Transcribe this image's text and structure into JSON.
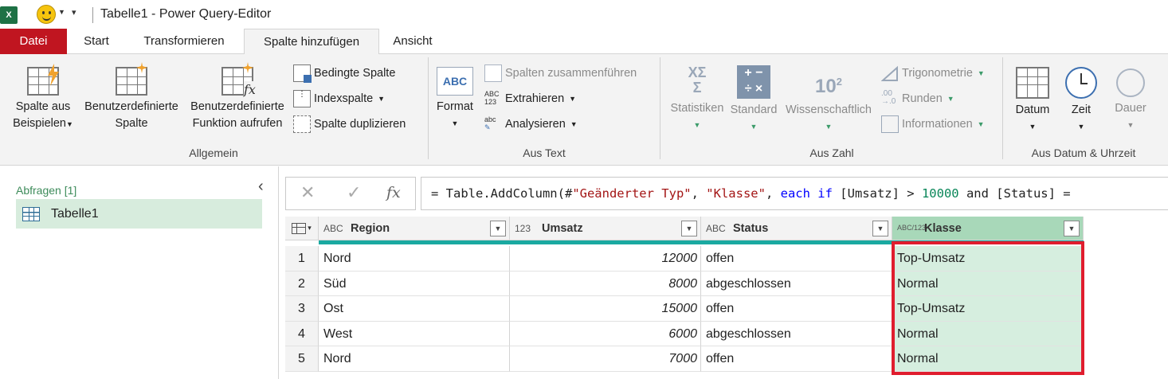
{
  "window": {
    "title": "Tabelle1 - Power Query-Editor",
    "app_icon": "X"
  },
  "tabs": [
    {
      "label": "Datei"
    },
    {
      "label": "Start"
    },
    {
      "label": "Transformieren"
    },
    {
      "label": "Spalte hinzufügen"
    },
    {
      "label": "Ansicht"
    }
  ],
  "active_tab": "Spalte hinzufügen",
  "ribbon": {
    "allgemein": {
      "label": "Allgemein",
      "spalte_aus_beispielen": [
        "Spalte aus",
        "Beispielen"
      ],
      "benutzerdef_spalte": [
        "Benutzerdefinierte",
        "Spalte"
      ],
      "benutzerdef_funktion": [
        "Benutzerdefinierte",
        "Funktion aufrufen"
      ],
      "bedingte_spalte": "Bedingte Spalte",
      "indexspalte": "Indexspalte",
      "spalte_duplizieren": "Spalte duplizieren"
    },
    "aus_text": {
      "label": "Aus Text",
      "format": "Format",
      "format_icon_text": "ABC",
      "spalten_zusammen": "Spalten zusammenführen",
      "extrahieren": "Extrahieren",
      "analysieren": "Analysieren"
    },
    "aus_zahl": {
      "label": "Aus Zahl",
      "statistiken": "Statistiken",
      "standard": "Standard",
      "wissenschaftlich": "Wissenschaftlich",
      "trigonometrie": "Trigonometrie",
      "runden": "Runden",
      "informationen": "Informationen"
    },
    "aus_datum": {
      "label": "Aus Datum & Uhrzeit",
      "datum": "Datum",
      "zeit": "Zeit",
      "dauer": "Dauer"
    }
  },
  "queries": {
    "label": "Abfragen [1]",
    "items": [
      {
        "name": "Tabelle1"
      }
    ]
  },
  "formula_bar": {
    "cancel": "✕",
    "confirm": "✓",
    "fx": "fx",
    "parts": {
      "p1": "= Table.AddColumn(#",
      "s1": "\"Geänderter Typ\"",
      "p2": ", ",
      "s2": "\"Klasse\"",
      "p3": ", ",
      "k1": "each",
      "p4": " ",
      "k2": "if",
      "p5": " [Umsatz] > ",
      "n1": "10000",
      "p6": " and [Status] ="
    }
  },
  "table": {
    "columns": [
      {
        "type": "ABC",
        "name": "Region"
      },
      {
        "type": "123",
        "name": "Umsatz"
      },
      {
        "type": "ABC",
        "name": "Status"
      },
      {
        "type": "ABC/123",
        "name": "Klasse"
      }
    ],
    "rows": [
      {
        "n": "1",
        "region": "Nord",
        "umsatz": "12000",
        "status": "offen",
        "klasse": "Top-Umsatz"
      },
      {
        "n": "2",
        "region": "Süd",
        "umsatz": "8000",
        "status": "abgeschlossen",
        "klasse": "Normal"
      },
      {
        "n": "3",
        "region": "Ost",
        "umsatz": "15000",
        "status": "offen",
        "klasse": "Top-Umsatz"
      },
      {
        "n": "4",
        "region": "West",
        "umsatz": "6000",
        "status": "abgeschlossen",
        "klasse": "Normal"
      },
      {
        "n": "5",
        "region": "Nord",
        "umsatz": "7000",
        "status": "offen",
        "klasse": "Normal"
      }
    ]
  },
  "colors": {
    "accent_red": "#c01520",
    "highlight": "#e01d2e",
    "teal": "#1aa9a1",
    "green": "#a8d8b9"
  }
}
